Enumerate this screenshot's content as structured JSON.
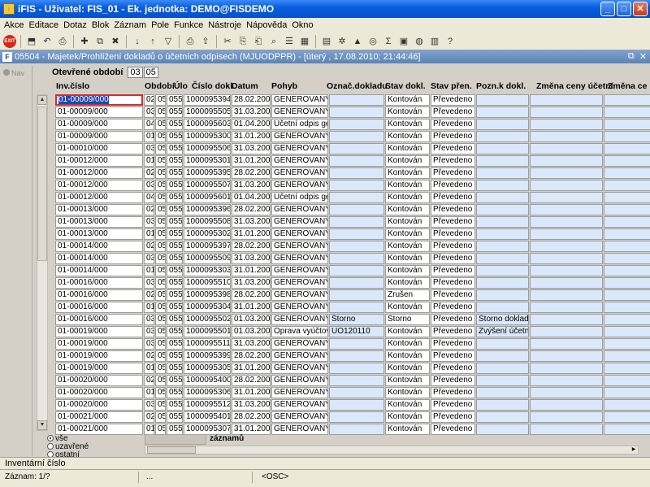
{
  "window": {
    "title": "iFIS - Uživatel: FIS_01 - Ek. jednotka: DEMO@FISDEMO"
  },
  "menu": [
    "Akce",
    "Editace",
    "Dotaz",
    "Blok",
    "Záznam",
    "Pole",
    "Funkce",
    "Nástroje",
    "Nápověda",
    "Okno"
  ],
  "toolbar": {
    "exit_label": "EXIT"
  },
  "form": {
    "title": "05504 - Majetek/Prohlížení dokladů o účetních odpisech (MJUODPPR) - [úterý , 17.08.2010; 21:44:46]",
    "nav_label": "Nav",
    "period_label": "Otevřené období",
    "period_month": "03",
    "period_year": "05"
  },
  "columns": [
    "Inv.číslo",
    "Období",
    "Úlo",
    "Číslo dokl.",
    "Datum",
    "Pohyb",
    "Označ.dokladu",
    "Stav dokl.",
    "Stav přen.",
    "Pozn.k dokl.",
    "Změna ceny účetní",
    "Změna ce"
  ],
  "rows": [
    [
      "01-00009/000",
      "02",
      "05",
      "055",
      "1000095394",
      "28.02.2005",
      "GENEROVANÝ úč",
      "",
      "Kontován",
      "Převedeno",
      "",
      ""
    ],
    [
      "01-00009/000",
      "03",
      "05",
      "055",
      "1000095505",
      "31.03.2005",
      "GENEROVANÝ úč",
      "",
      "Kontován",
      "Převedeno",
      "",
      ""
    ],
    [
      "01-00009/000",
      "04",
      "05",
      "055",
      "1000095603",
      "01.04.2005",
      "Účetní odpis gene",
      "",
      "Kontován",
      "Převedeno",
      "",
      ""
    ],
    [
      "01-00009/000",
      "01",
      "05",
      "055",
      "1000095300",
      "31.01.2005",
      "GENEROVANÝ úč",
      "",
      "Kontován",
      "Převedeno",
      "",
      ""
    ],
    [
      "01-00010/000",
      "03",
      "05",
      "055",
      "1000095506",
      "31.03.2005",
      "GENEROVANÝ úč",
      "",
      "Kontován",
      "Převedeno",
      "",
      ""
    ],
    [
      "01-00012/000",
      "01",
      "05",
      "055",
      "1000095301",
      "31.01.2005",
      "GENEROVANÝ úč",
      "",
      "Kontován",
      "Převedeno",
      "",
      ""
    ],
    [
      "01-00012/000",
      "02",
      "05",
      "055",
      "1000095395",
      "28.02.2005",
      "GENEROVANÝ úč",
      "",
      "Kontován",
      "Převedeno",
      "",
      ""
    ],
    [
      "01-00012/000",
      "03",
      "05",
      "055",
      "1000095507",
      "31.03.2005",
      "GENEROVANÝ úč",
      "",
      "Kontován",
      "Převedeno",
      "",
      ""
    ],
    [
      "01-00012/000",
      "04",
      "05",
      "055",
      "1000095601",
      "01.04.2005",
      "Účetní odpis gene",
      "",
      "Kontován",
      "Převedeno",
      "",
      ""
    ],
    [
      "01-00013/000",
      "02",
      "05",
      "055",
      "1000095396",
      "28.02.2005",
      "GENEROVANÝ úč",
      "",
      "Kontován",
      "Převedeno",
      "",
      ""
    ],
    [
      "01-00013/000",
      "03",
      "05",
      "055",
      "1000095508",
      "31.03.2005",
      "GENEROVANÝ úč",
      "",
      "Kontován",
      "Převedeno",
      "",
      ""
    ],
    [
      "01-00013/000",
      "01",
      "05",
      "055",
      "1000095302",
      "31.01.2005",
      "GENEROVANÝ úč",
      "",
      "Kontován",
      "Převedeno",
      "",
      ""
    ],
    [
      "01-00014/000",
      "02",
      "05",
      "055",
      "1000095397",
      "28.02.2005",
      "GENEROVANÝ úč",
      "",
      "Kontován",
      "Převedeno",
      "",
      ""
    ],
    [
      "01-00014/000",
      "03",
      "05",
      "055",
      "1000095509",
      "31.03.2005",
      "GENEROVANÝ úč",
      "",
      "Kontován",
      "Převedeno",
      "",
      ""
    ],
    [
      "01-00014/000",
      "01",
      "05",
      "055",
      "1000095303",
      "31.01.2005",
      "GENEROVANÝ úč",
      "",
      "Kontován",
      "Převedeno",
      "",
      ""
    ],
    [
      "01-00016/000",
      "03",
      "05",
      "055",
      "1000095510",
      "31.03.2005",
      "GENEROVANÝ úč",
      "",
      "Kontován",
      "Převedeno",
      "",
      ""
    ],
    [
      "01-00016/000",
      "02",
      "05",
      "055",
      "1000095398",
      "28.02.2005",
      "GENEROVANÝ úč",
      "",
      "Zrušen",
      "Převedeno",
      "",
      ""
    ],
    [
      "01-00016/000",
      "01",
      "05",
      "055",
      "1000095304",
      "31.01.2005",
      "GENEROVANÝ úč",
      "",
      "Kontován",
      "Převedeno",
      "",
      ""
    ],
    [
      "01-00016/000",
      "03",
      "05",
      "055",
      "1000095502",
      "01.03.2005",
      "GENEROVANÝ úč",
      "Storno",
      "Storno",
      "Převedeno",
      "Storno dokladu1",
      ""
    ],
    [
      "01-00019/000",
      "03",
      "05",
      "055",
      "1000095501",
      "01.03.2005",
      "Oprava vyúčtovar",
      "UO120110",
      "Kontován",
      "Převedeno",
      "Zvýšení účetníc",
      ""
    ],
    [
      "01-00019/000",
      "03",
      "05",
      "055",
      "1000095511",
      "31.03.2005",
      "GENEROVANÝ úč",
      "",
      "Kontován",
      "Převedeno",
      "",
      ""
    ],
    [
      "01-00019/000",
      "02",
      "05",
      "055",
      "1000095399",
      "28.02.2005",
      "GENEROVANÝ úč",
      "",
      "Kontován",
      "Převedeno",
      "",
      ""
    ],
    [
      "01-00019/000",
      "01",
      "05",
      "055",
      "1000095305",
      "31.01.2005",
      "GENEROVANÝ úč",
      "",
      "Kontován",
      "Převedeno",
      "",
      ""
    ],
    [
      "01-00020/000",
      "02",
      "05",
      "055",
      "1000095400",
      "28.02.2005",
      "GENEROVANÝ úč",
      "",
      "Kontován",
      "Převedeno",
      "",
      ""
    ],
    [
      "01-00020/000",
      "01",
      "05",
      "055",
      "1000095306",
      "31.01.2005",
      "GENEROVANÝ úč",
      "",
      "Kontován",
      "Převedeno",
      "",
      ""
    ],
    [
      "01-00020/000",
      "03",
      "05",
      "055",
      "1000095512",
      "31.03.2005",
      "GENEROVANÝ úč",
      "",
      "Kontován",
      "Převedeno",
      "",
      ""
    ],
    [
      "01-00021/000",
      "02",
      "05",
      "055",
      "1000095401",
      "28.02.2005",
      "GENEROVANÝ úč",
      "",
      "Kontován",
      "Převedeno",
      "",
      ""
    ],
    [
      "01-00021/000",
      "01",
      "05",
      "055",
      "1000095307",
      "31.01.2005",
      "GENEROVANÝ úč",
      "",
      "Kontován",
      "Převedeno",
      "",
      ""
    ]
  ],
  "filter": {
    "options": [
      "vše",
      "uzavřené",
      "ostatní"
    ],
    "selected": "vše"
  },
  "count_label": "záznamů",
  "status": {
    "field_hint": "Inventární číslo",
    "record": "Záznam: 1/?",
    "dots": "...",
    "mode": "<OSC>"
  }
}
